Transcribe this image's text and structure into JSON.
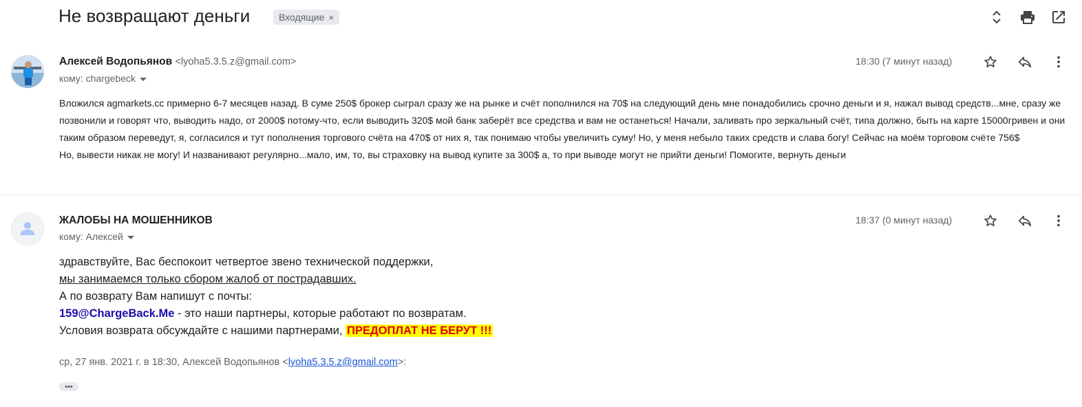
{
  "header": {
    "subject": "Не возвращают деньги",
    "label": "Входящие",
    "label_close": "×"
  },
  "messages": [
    {
      "sender_name": "Алексей Водопьянов",
      "sender_email": "<lyoha5.3.5.z@gmail.com>",
      "recipient": "кому: chargebeck",
      "time": "18:30 (7 минут назад)",
      "paragraphs": [
        "Вложился agmarkets.cc примерно 6-7 месяцев назад. В суме 250$ брокер сыграл сразу же на рынке и счёт пополнился на 70$ на следующий день мне понадобились срочно деньги и я, нажал вывод средств...мне, сразу же позвонили и говорят что, выводить надо, от 2000$ потому-что, если выводить 320$ мой банк заберёт все средства и вам не останеться! Начали, заливать про зеркальный счёт, типа должно, быть на карте 15000гривен и они таким образом переведут, я, согласился и тут пополнения торгового счёта на 470$ от них я, так понимаю чтобы увеличить суму! Но, у меня небыло таких средств и слава богу! Сейчас на моём торговом счёте 756$",
        "Но, вывести никак не могу! И названивают регулярно...мало, им, то, вы страховку на вывод купите за 300$ а, то при выводе могут не прийти деньги! Помогите, вернуть деньги"
      ]
    },
    {
      "sender_name": "ЖАЛОБЫ НА МОШЕННИКОВ",
      "recipient": "кому: Алексей",
      "time": "18:37 (0 минут назад)",
      "line1": "здравствуйте, Вас беспокоит четвертое звено технической поддержки,",
      "line2": "мы занимаемся только сбором жалоб от пострадавших.",
      "line3": "А по возврату Вам напишут с почты:",
      "email_link": "159@ChargeBack.Me",
      "line4_rest": " - это наши партнеры, которые работают по возвратам.",
      "line5": "Условия возврата обсуждайте с нашими партнерами, ",
      "highlight": "ПРЕДОПЛАТ НЕ БЕРУТ !!!",
      "quote_prefix": "ср, 27 янв. 2021 г. в 18:30, Алексей Водопьянов <",
      "quote_email": "lyoha5.3.5.z@gmail.com",
      "quote_suffix": ">:",
      "ellipsis": "•••"
    }
  ],
  "icons": {
    "expand": "unfold-icon",
    "print": "print-icon",
    "popout": "open-in-new-icon",
    "star": "star-outline-icon",
    "reply": "reply-icon",
    "more": "more-vert-icon",
    "avatar_default": "person-icon"
  },
  "colors": {
    "link": "#1a0dab",
    "highlight_bg": "#ffff00",
    "highlight_text": "#e00000",
    "chip_bg": "#e8eaed",
    "muted": "#5f6368"
  }
}
